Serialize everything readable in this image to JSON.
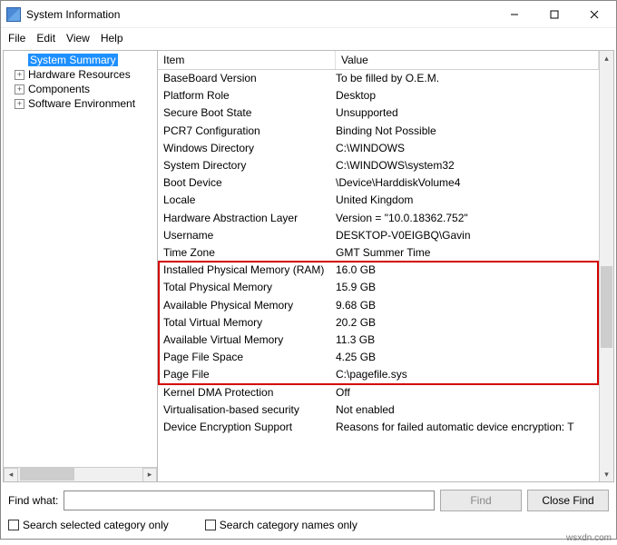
{
  "window": {
    "title": "System Information"
  },
  "menu": [
    "File",
    "Edit",
    "View",
    "Help"
  ],
  "tree": {
    "root": "System Summary",
    "children": [
      "Hardware Resources",
      "Components",
      "Software Environment"
    ]
  },
  "columns": {
    "item": "Item",
    "value": "Value"
  },
  "rows": [
    {
      "item": "BaseBoard Version",
      "value": "To be filled by O.E.M."
    },
    {
      "item": "Platform Role",
      "value": "Desktop"
    },
    {
      "item": "Secure Boot State",
      "value": "Unsupported"
    },
    {
      "item": "PCR7 Configuration",
      "value": "Binding Not Possible"
    },
    {
      "item": "Windows Directory",
      "value": "C:\\WINDOWS"
    },
    {
      "item": "System Directory",
      "value": "C:\\WINDOWS\\system32"
    },
    {
      "item": "Boot Device",
      "value": "\\Device\\HarddiskVolume4"
    },
    {
      "item": "Locale",
      "value": "United Kingdom"
    },
    {
      "item": "Hardware Abstraction Layer",
      "value": "Version = \"10.0.18362.752\""
    },
    {
      "item": "Username",
      "value": "DESKTOP-V0EIGBQ\\Gavin"
    },
    {
      "item": "Time Zone",
      "value": "GMT Summer Time"
    },
    {
      "item": "Installed Physical Memory (RAM)",
      "value": "16.0 GB"
    },
    {
      "item": "Total Physical Memory",
      "value": "15.9 GB"
    },
    {
      "item": "Available Physical Memory",
      "value": "9.68 GB"
    },
    {
      "item": "Total Virtual Memory",
      "value": "20.2 GB"
    },
    {
      "item": "Available Virtual Memory",
      "value": "11.3 GB"
    },
    {
      "item": "Page File Space",
      "value": "4.25 GB"
    },
    {
      "item": "Page File",
      "value": "C:\\pagefile.sys"
    },
    {
      "item": "Kernel DMA Protection",
      "value": "Off"
    },
    {
      "item": "Virtualisation-based security",
      "value": "Not enabled"
    },
    {
      "item": "Device Encryption Support",
      "value": "Reasons for failed automatic device encryption: T"
    }
  ],
  "highlight": {
    "startRow": 11,
    "endRow": 17
  },
  "find": {
    "label": "Find what:",
    "value": "",
    "findBtn": "Find",
    "closeBtn": "Close Find",
    "checkSelected": "Search selected category only",
    "checkNames": "Search category names only"
  },
  "watermark": "wsxdn.com"
}
